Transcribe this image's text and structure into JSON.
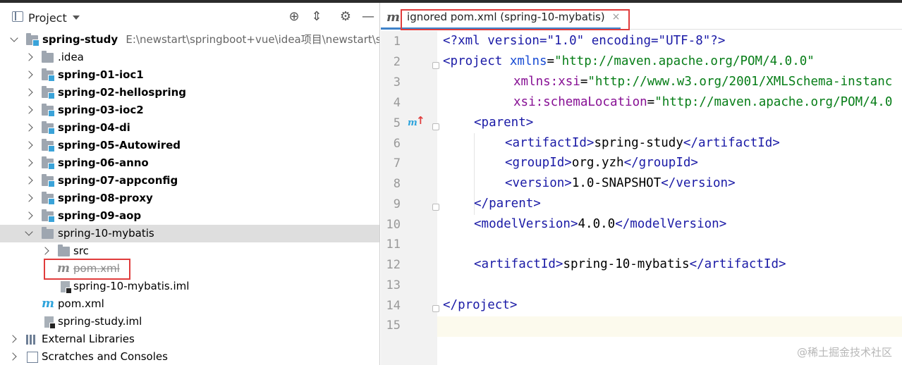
{
  "panel": {
    "title": "Project",
    "tools": [
      "locate-icon",
      "collapse-icon",
      "gear-icon",
      "minimize-icon"
    ]
  },
  "tree": {
    "root_label": "spring-study",
    "root_path": "E:\\newstart\\springboot+vue\\idea项目\\newstart\\spri",
    "idea": ".idea",
    "modules": [
      "spring-01-ioc1",
      "spring-02-hellospring",
      "spring-03-ioc2",
      "spring-04-di",
      "spring-05-Autowired",
      "spring-06-anno",
      "spring-07-appconfig",
      "spring-08-proxy",
      "spring-09-aop"
    ],
    "selected_module": "spring-10-mybatis",
    "src": "src",
    "ignored_pom": "pom.xml",
    "module_iml": "spring-10-mybatis.iml",
    "root_pom": "pom.xml",
    "root_iml": "spring-study.iml",
    "external_libraries": "External Libraries",
    "scratches": "Scratches and Consoles"
  },
  "editor": {
    "tab_label": "ignored pom.xml (spring-10-mybatis)",
    "tab_close": "×",
    "line_numbers": [
      "1",
      "2",
      "3",
      "4",
      "5",
      "6",
      "7",
      "8",
      "9",
      "10",
      "11",
      "12",
      "13",
      "14",
      "15"
    ],
    "lines": {
      "l1": "<?xml version=\"1.0\" encoding=\"UTF-8\"?>",
      "l2_tag": "<project",
      "l2_attr": " xmlns",
      "l2_eq": "=",
      "l2_val": "\"http://maven.apache.org/POM/4.0.0\"",
      "l3_ns": "xmlns:xsi",
      "l3_val": "\"http://www.w3.org/2001/XMLSchema-instanc",
      "l4_ns": "xsi:schemaLocation",
      "l4_val": "\"http://maven.apache.org/POM/4.0",
      "l5": "<parent>",
      "l6_open": "<artifactId>",
      "l6_text": "spring-study",
      "l6_close": "</artifactId>",
      "l7_open": "<groupId>",
      "l7_text": "org.yzh",
      "l7_close": "</groupId>",
      "l8_open": "<version>",
      "l8_text": "1.0-SNAPSHOT",
      "l8_close": "</version>",
      "l9": "</parent>",
      "l10_open": "<modelVersion>",
      "l10_text": "4.0.0",
      "l10_close": "</modelVersion>",
      "l12_open": "<artifactId>",
      "l12_text": "spring-10-mybatis",
      "l12_close": "</artifactId>",
      "l14": "</project>"
    }
  },
  "watermark": "@稀土掘金技术社区",
  "colors": {
    "tag": "#1a1aa6",
    "namespace": "#871094",
    "string": "#067d17",
    "highlight": "#e03c3c",
    "selection": "#dedede"
  }
}
